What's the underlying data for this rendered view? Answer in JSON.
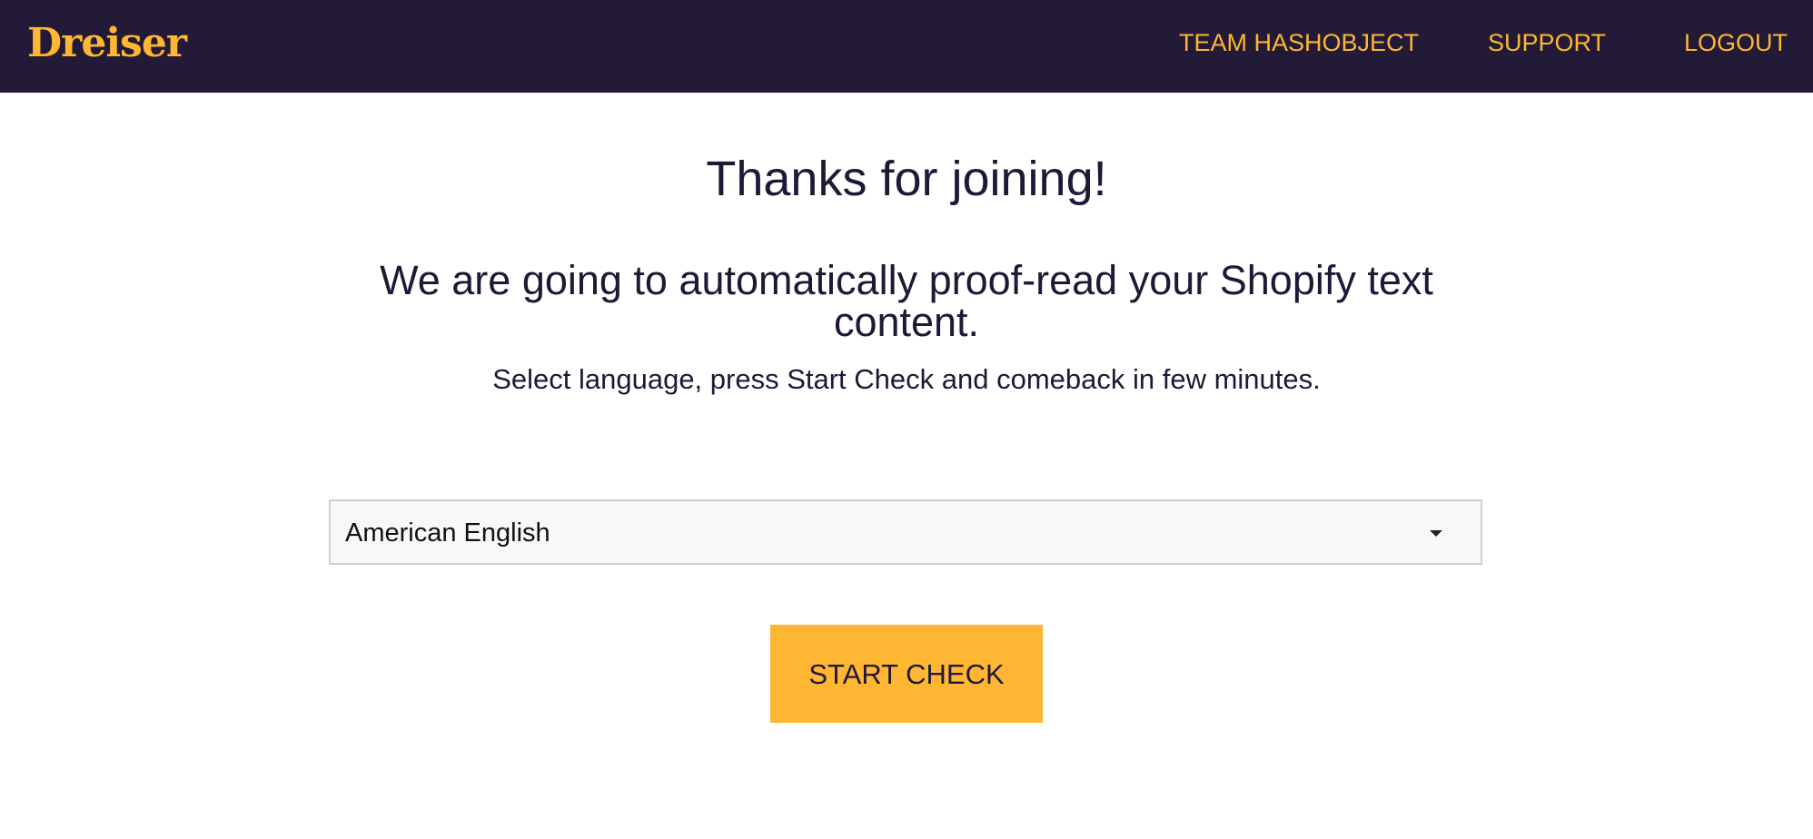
{
  "header": {
    "logo": "Dreiser",
    "nav": {
      "team": "TEAM HASHOBJECT",
      "support": "SUPPORT",
      "logout": "LOGOUT"
    }
  },
  "main": {
    "title": "Thanks for joining!",
    "subtitle": "We are going to automatically proof-read your Shopify text content.",
    "instruction": "Select language, press Start Check and comeback in few minutes.",
    "language_select": {
      "selected": "American English"
    },
    "start_button": "START CHECK"
  },
  "colors": {
    "header_bg": "#221a36",
    "accent": "#ffb632",
    "text_dark": "#1e1936",
    "select_bg": "#f8f8f8"
  },
  "icons": {
    "select_arrow": "caret-down-icon"
  }
}
